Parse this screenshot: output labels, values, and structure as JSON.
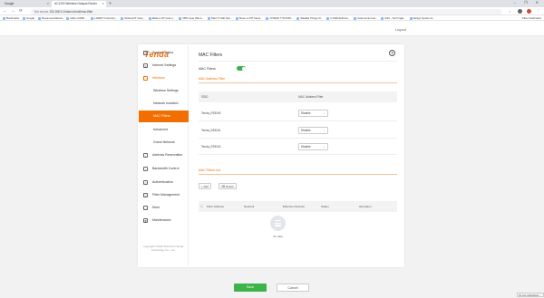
{
  "browser": {
    "tabs": [
      {
        "label": "Google"
      },
      {
        "label": "AC1200 Wireless Hotspot Router"
      }
    ],
    "new_tab": "+",
    "window_controls": "– ❐ ✕",
    "nav_back": "←",
    "nav_forward": "→",
    "nav_reload": "⟳",
    "security": "Not secure",
    "url": "192.168.0.1/index.html#/mac-filter",
    "bookmarks": [
      "Bookmarks",
      "Google",
      "Recommendations",
      "table of ARR ...",
      "LAKIET frontend p...",
      "Referral IT shop...",
      "Make a XP code p...",
      "VPM route ISE to...",
      "Start IT 10kt Stor...",
      "Repo on PP frame...",
      "COSMO TYM 6/30...",
      "Satellite Things Or...",
      "In R/Rebuild de...",
      "Instruments test...",
      "C&C - Tech Ingle...",
      "Design System &..."
    ],
    "other_bookmarks": "Other bookmarks"
  },
  "page": {
    "brand": "Tenda",
    "logout": "Logout"
  },
  "sidebar": {
    "items": [
      {
        "label": "System Status",
        "icon": "monitor-icon",
        "glyph": "▭"
      },
      {
        "label": "Internet Settings",
        "icon": "globe-icon",
        "glyph": "◎"
      },
      {
        "label": "Wireless",
        "icon": "wifi-icon",
        "glyph": "◠"
      },
      {
        "label": "Wireless Settings"
      },
      {
        "label": "Network Isolation"
      },
      {
        "label": "MAC Filters"
      },
      {
        "label": "Advanced"
      },
      {
        "label": "Guest Network"
      },
      {
        "label": "Address Reservation",
        "icon": "pin-icon",
        "glyph": "•"
      },
      {
        "label": "Bandwidth Control",
        "icon": "gauge-icon",
        "glyph": "◔"
      },
      {
        "label": "Authentication",
        "icon": "shield-icon",
        "glyph": "◇"
      },
      {
        "label": "Filter Management",
        "icon": "filter-icon",
        "glyph": "▽"
      },
      {
        "label": "More",
        "icon": "more-icon",
        "glyph": "⋯"
      },
      {
        "label": "Maintenance",
        "icon": "gear-icon",
        "glyph": "✱"
      }
    ],
    "copyright": "Copyright ©2019 Shenzhen Tenda Technology Co., Ltd."
  },
  "main": {
    "title": "MAC Filters",
    "help": "?",
    "filter_label": "MAC Filters",
    "filter_enabled": true,
    "policy_section": "MAC Address Filter",
    "policy_headers": {
      "ssid": "SSID",
      "mode": "MAC Address Filter"
    },
    "policies": [
      {
        "ssid": "Tenda_E93240",
        "mode": "Disable"
      },
      {
        "ssid": "Tenda_E93241",
        "mode": "Disable"
      },
      {
        "ssid": "Tenda_E93242",
        "mode": "Disable"
      }
    ],
    "list_section": "MAC Filters List",
    "add": "Add",
    "delete": "Delete",
    "list_headers": [
      "MAC Address",
      "Network",
      "Effective Network",
      "Status",
      "Operation"
    ],
    "empty_text": "No data"
  },
  "footer": {
    "save": "Save",
    "cancel": "Cancel"
  },
  "status_bar": "No new notifications",
  "colors": {
    "accent": "#f26e00",
    "save": "#3db34a",
    "toggle_on": "#37b24d"
  }
}
